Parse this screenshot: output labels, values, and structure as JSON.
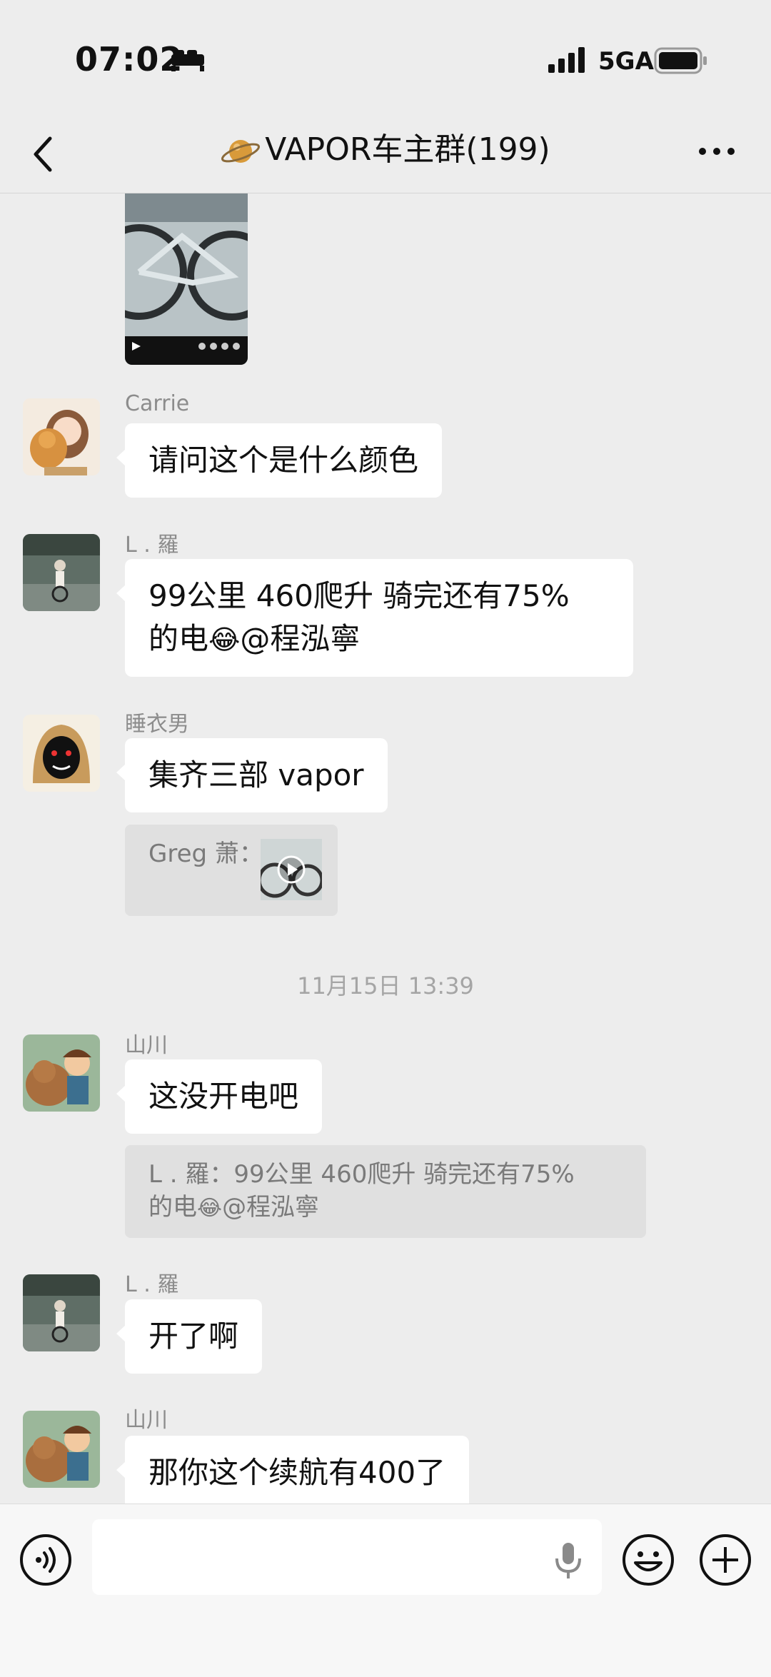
{
  "status_bar": {
    "time": "07:02",
    "network": "5GA"
  },
  "header": {
    "title": "VAPOR车主群(199)"
  },
  "messages": {
    "m1": {
      "sender": "Carrie",
      "text": "请问这个是什么颜色"
    },
    "m2": {
      "sender": "L . 羅",
      "text": "99公里 460爬升  骑完还有75%",
      "text2": "的电",
      "emoji": "😂",
      "text3": "@程泓寧"
    },
    "m3": {
      "sender": "睡衣男",
      "text": "集齐三部 vapor",
      "quote_label": "Greg 萧："
    },
    "timestamp": "11月15日 13:39",
    "m4": {
      "sender": "山川",
      "text": "这没开电吧",
      "quote_line1": "L . 羅：99公里 460爬升  骑完还有75%",
      "quote_line2a": "的电",
      "quote_emoji": "😂",
      "quote_line2b": "@程泓寧"
    },
    "m5": {
      "sender": "L . 羅",
      "text": "开了啊"
    },
    "m6": {
      "sender": "山川",
      "text": "那你这个续航有400了"
    }
  },
  "input": {
    "placeholder": ""
  },
  "icons": [
    "bed-icon",
    "signal-icon",
    "battery-icon",
    "back-icon",
    "planet-icon",
    "more-icon",
    "voice-icon",
    "mic-icon",
    "emoji-icon",
    "plus-icon",
    "play-icon"
  ],
  "colors": {
    "background": "#ededed",
    "bubble": "#ffffff",
    "quote": "#e0e0e0",
    "input_bar": "#f7f7f7"
  }
}
